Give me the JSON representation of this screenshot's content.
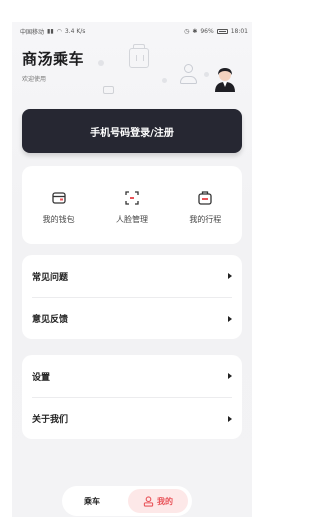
{
  "statusbar": {
    "carrier": "中国移动",
    "speed": "3.4 K/s",
    "battery": "96%",
    "time": "18:01"
  },
  "header": {
    "title": "商汤乘车",
    "subtitle": "欢迎使用"
  },
  "login_button": "手机号码登录/注册",
  "quick_actions": [
    {
      "label": "我的钱包",
      "icon": "wallet-icon"
    },
    {
      "label": "人脸管理",
      "icon": "face-scan-icon"
    },
    {
      "label": "我的行程",
      "icon": "trip-icon"
    }
  ],
  "menu_group_1": [
    {
      "label": "常见问题"
    },
    {
      "label": "意见反馈"
    }
  ],
  "menu_group_2": [
    {
      "label": "设置"
    },
    {
      "label": "关于我们"
    }
  ],
  "tabbar": {
    "ride": "乘车",
    "mine": "我的"
  },
  "colors": {
    "primary_dark": "#262732",
    "accent": "#e9545a",
    "accent_bg": "#fde8e8",
    "background": "#f3f3f5"
  }
}
